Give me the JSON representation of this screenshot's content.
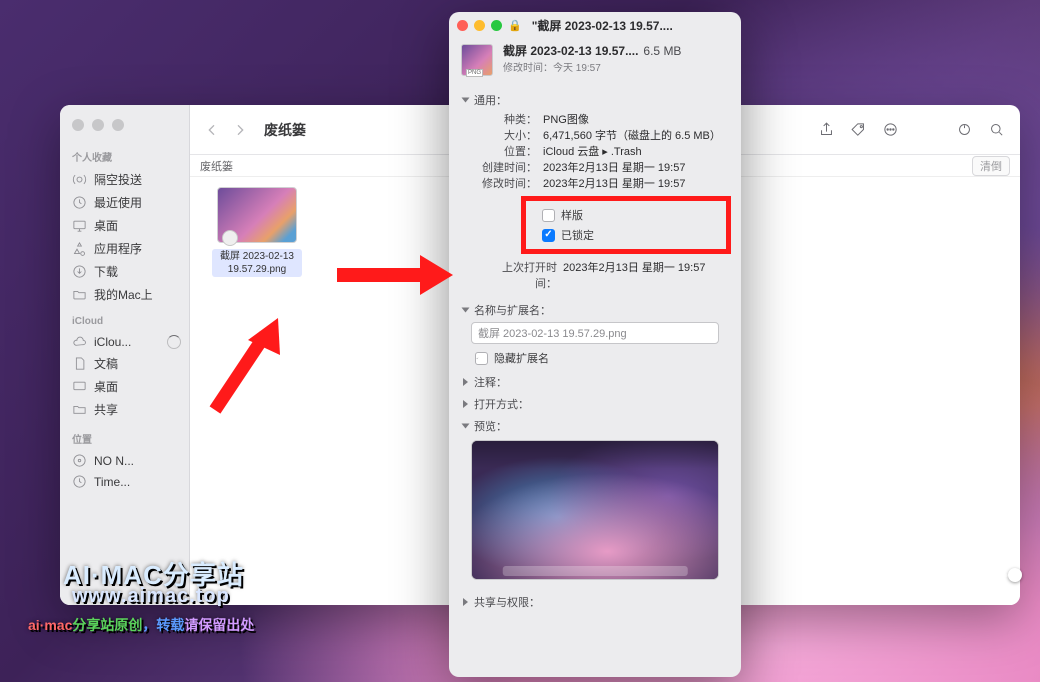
{
  "finder": {
    "title": "废纸篓",
    "pathbar": "废纸篓",
    "empty_button": "清倒",
    "sidebar": {
      "favorites_label": "个人收藏",
      "items_fav": [
        {
          "label": "隔空投送"
        },
        {
          "label": "最近使用"
        },
        {
          "label": "桌面"
        },
        {
          "label": "应用程序"
        },
        {
          "label": "下载"
        },
        {
          "label": "我的Mac上"
        }
      ],
      "icloud_label": "iCloud",
      "items_icloud": [
        {
          "label": "iClou..."
        },
        {
          "label": "文稿"
        },
        {
          "label": "桌面"
        },
        {
          "label": "共享"
        }
      ],
      "locations_label": "位置",
      "items_loc": [
        {
          "label": "NO N..."
        },
        {
          "label": "Time..."
        }
      ]
    },
    "file": {
      "name_line1": "截屏 2023-02-13",
      "name_line2": "19.57.29.png"
    }
  },
  "info": {
    "window_title": "\"截屏 2023-02-13 19.57....",
    "header_name": "截屏 2023-02-13 19.57....",
    "header_size": "6.5 MB",
    "header_mod_label": "修改时间：",
    "header_mod_value": "今天 19:57",
    "general_label": "通用：",
    "kv": {
      "kind_k": "种类：",
      "kind_v": "PNG图像",
      "size_k": "大小：",
      "size_v": "6,471,560 字节（磁盘上的 6.5 MB）",
      "where_k": "位置：",
      "where_v": "iCloud 云盘 ▸ .Trash",
      "created_k": "创建时间：",
      "created_v": "2023年2月13日 星期一 19:57",
      "modified_k": "修改时间：",
      "modified_v": "2023年2月13日 星期一 19:57"
    },
    "stationery_label": "样版",
    "locked_label": "已锁定",
    "locked": true,
    "lastopen_k": "上次打开时间：",
    "lastopen_v": "2023年2月13日 星期一 19:57",
    "name_ext_label": "名称与扩展名：",
    "filename": "截屏 2023-02-13 19.57.29.png",
    "hide_ext_label": "隐藏扩展名",
    "comments_label": "注释：",
    "openwith_label": "打开方式：",
    "preview_label": "预览：",
    "sharing_label": "共享与权限："
  },
  "watermark": {
    "line1": "AI·MAC分享站",
    "line2": "www.aimac.top",
    "line3_a": "ai·mac",
    "line3_b": "分享站原创",
    "line3_c": "，转载",
    "line3_d": "请保留出处"
  }
}
